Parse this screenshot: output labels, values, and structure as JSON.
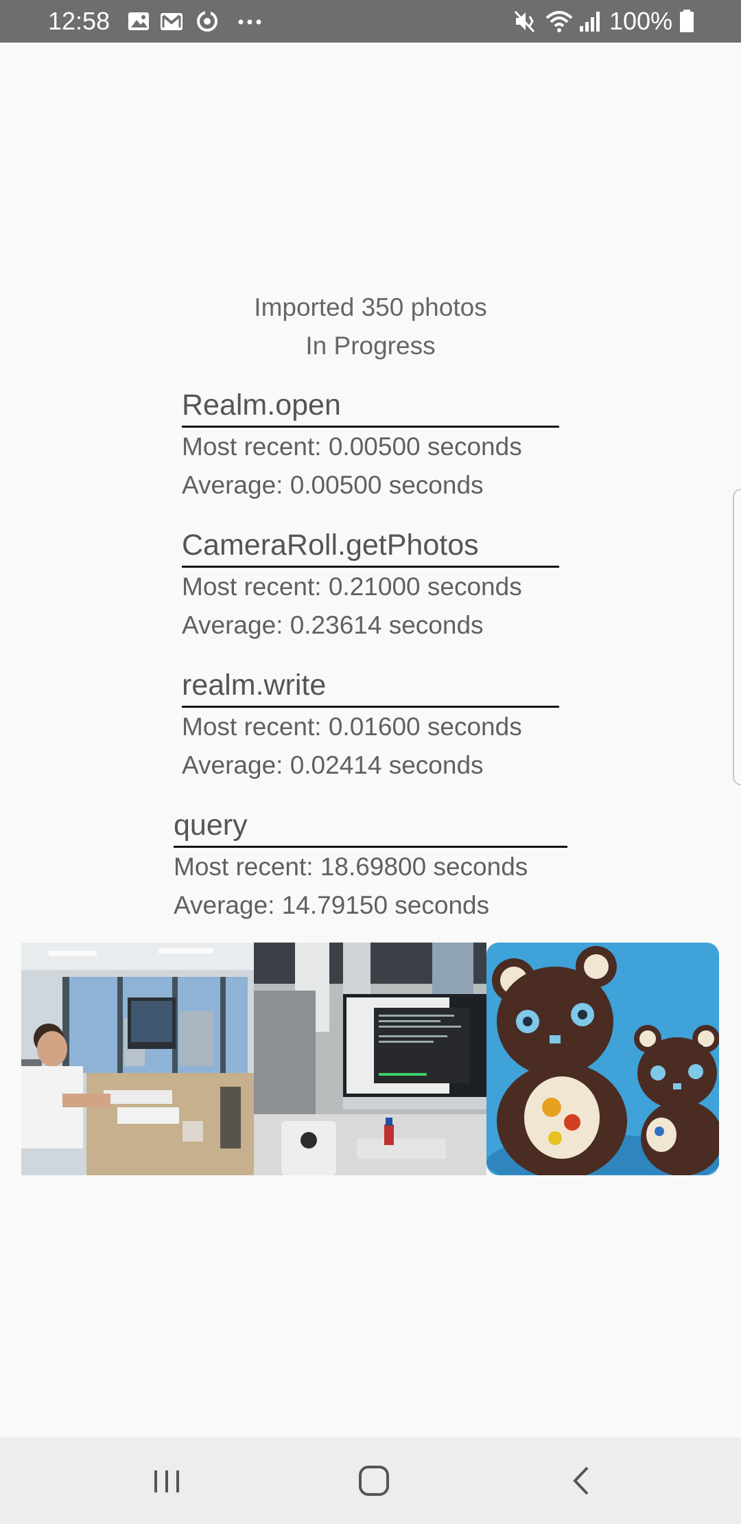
{
  "status_bar": {
    "time": "12:58",
    "battery_percent": "100%",
    "icons_left": [
      "gallery-icon",
      "gmail-icon",
      "sync-icon",
      "more-icon"
    ],
    "icons_right": [
      "mute-icon",
      "wifi-icon",
      "signal-icon",
      "battery-icon"
    ]
  },
  "header": {
    "imported": "Imported 350 photos",
    "status": "In Progress"
  },
  "metrics": [
    {
      "name": "Realm.open",
      "most_recent": "Most recent: 0.00500 seconds",
      "average": "Average: 0.00500 seconds"
    },
    {
      "name": "CameraRoll.getPhotos",
      "most_recent": "Most recent: 0.21000 seconds",
      "average": "Average: 0.23614 seconds"
    },
    {
      "name": "realm.write",
      "most_recent": "Most recent: 0.01600 seconds",
      "average": "Average: 0.02414 seconds"
    },
    {
      "name": "query",
      "most_recent": "Most recent: 18.69800 seconds",
      "average": "Average: 14.79150 seconds"
    }
  ],
  "photos": [
    "office-desk-photo",
    "monitor-terminal-photo",
    "plush-bears-photo"
  ],
  "nav": {
    "recents": "recent-apps-icon",
    "home": "home-icon",
    "back": "back-icon"
  },
  "colors": {
    "status_bar": "#6e6e6e",
    "background": "#f9f9f9",
    "nav_bar": "#ededed",
    "text": "#5f5f5f"
  }
}
